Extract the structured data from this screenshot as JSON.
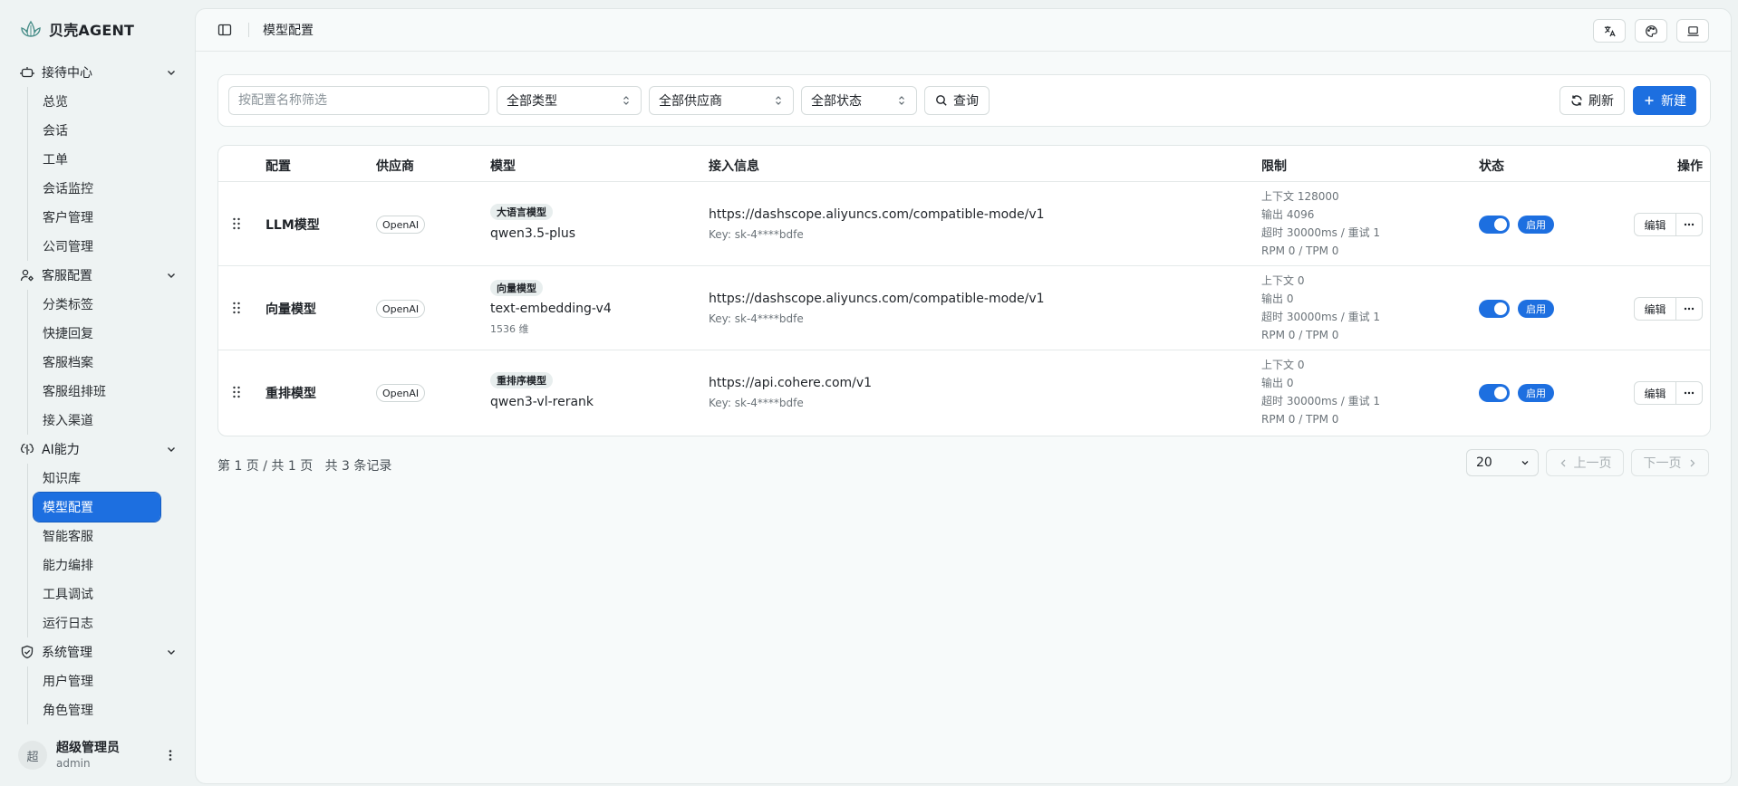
{
  "app": {
    "brand": "贝壳AGENT"
  },
  "sidebar": {
    "groups": [
      {
        "label": "接待中心",
        "icon": "robot-icon",
        "items": [
          "总览",
          "会话",
          "工单",
          "会话监控",
          "客户管理",
          "公司管理"
        ]
      },
      {
        "label": "客服配置",
        "icon": "user-gear-icon",
        "items": [
          "分类标签",
          "快捷回复",
          "客服档案",
          "客服组排班",
          "接入渠道"
        ]
      },
      {
        "label": "AI能力",
        "icon": "ai-brain-icon",
        "items": [
          "知识库",
          "模型配置",
          "智能客服",
          "能力编排",
          "工具调试",
          "运行日志"
        ]
      },
      {
        "label": "系统管理",
        "icon": "shield-icon",
        "items": [
          "用户管理",
          "角色管理"
        ]
      }
    ],
    "active_item": "模型配置",
    "user": {
      "avatar_text": "超",
      "name": "超级管理员",
      "role": "admin"
    }
  },
  "header": {
    "breadcrumb": "模型配置"
  },
  "filters": {
    "name_placeholder": "按配置名称筛选",
    "type": "全部类型",
    "vendor": "全部供应商",
    "status": "全部状态",
    "query_label": "查询",
    "refresh_label": "刷新",
    "create_label": "新建"
  },
  "table": {
    "columns": [
      "配置",
      "供应商",
      "模型",
      "接入信息",
      "限制",
      "状态",
      "操作"
    ],
    "rows": [
      {
        "name": "LLM模型",
        "vendor": "OpenAI",
        "model_tag": "大语言模型",
        "model": "qwen3.5-plus",
        "dim": "",
        "url": "https://dashscope.aliyuncs.com/compatible-mode/v1",
        "key": "Key: sk-4****bdfe",
        "limits": [
          "上下文 128000",
          "输出 4096",
          "超时 30000ms / 重试 1",
          "RPM 0 / TPM 0"
        ],
        "enabled": true,
        "status": "启用",
        "edit": "编辑"
      },
      {
        "name": "向量模型",
        "vendor": "OpenAI",
        "model_tag": "向量模型",
        "model": "text-embedding-v4",
        "dim": "1536 维",
        "url": "https://dashscope.aliyuncs.com/compatible-mode/v1",
        "key": "Key: sk-4****bdfe",
        "limits": [
          "上下文 0",
          "输出 0",
          "超时 30000ms / 重试 1",
          "RPM 0 / TPM 0"
        ],
        "enabled": true,
        "status": "启用",
        "edit": "编辑"
      },
      {
        "name": "重排模型",
        "vendor": "OpenAI",
        "model_tag": "重排序模型",
        "model": "qwen3-vl-rerank",
        "dim": "",
        "url": "https://api.cohere.com/v1",
        "key": "Key: sk-4****bdfe",
        "limits": [
          "上下文 0",
          "输出 0",
          "超时 30000ms / 重试 1",
          "RPM 0 / TPM 0"
        ],
        "enabled": true,
        "status": "启用",
        "edit": "编辑"
      }
    ]
  },
  "pagination": {
    "info": "第 1 页 / 共 1 页   共 3 条记录",
    "page_size": "20",
    "prev": "上一页",
    "next": "下一页"
  },
  "colors": {
    "accent": "#1d6fe0",
    "background": "#eef3f3",
    "panel": "#f7fafa"
  }
}
